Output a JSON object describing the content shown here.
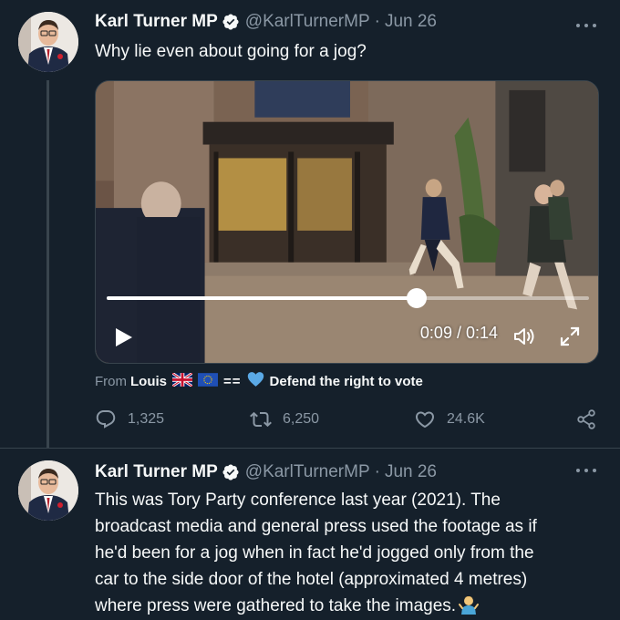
{
  "tweets": [
    {
      "author": {
        "name": "Karl Turner MP",
        "handle": "@KarlTurnerMP",
        "verified": true
      },
      "date": "Jun 26",
      "text": "Why lie even about going for a jog?",
      "video": {
        "current_time": "0:09",
        "duration": "0:14",
        "progress": 0.643,
        "timecode": "0:09 / 0:14"
      },
      "attribution": {
        "prefix": "From",
        "user": "Louis",
        "emoji_text": "==",
        "tail": "Defend the right to vote"
      },
      "counts": {
        "replies": "1,325",
        "retweets": "6,250",
        "likes": "24.6K"
      }
    },
    {
      "author": {
        "name": "Karl Turner MP",
        "handle": "@KarlTurnerMP",
        "verified": true
      },
      "date": "Jun 26",
      "lines": [
        "This was Tory Party conference last year (2021). The",
        "broadcast media and general press used the footage as if",
        "he'd been for a jog when in fact he'd jogged only from the",
        "car to the side door of the hotel (approximated 4 metres)",
        "where press were gathered to take the images."
      ]
    }
  ],
  "separator": "·",
  "icons": {
    "verified": "verified-badge-icon",
    "more": "more-options-icon",
    "reply": "reply-icon",
    "retweet": "retweet-icon",
    "like": "like-icon",
    "share": "share-icon",
    "play": "play-icon",
    "volume": "volume-icon",
    "fullscreen": "fullscreen-icon"
  },
  "colors": {
    "background": "#15202b",
    "text": "#f7f9f9",
    "muted": "#8b98a5",
    "border": "#38444d",
    "verified": "#f7f9f9"
  }
}
